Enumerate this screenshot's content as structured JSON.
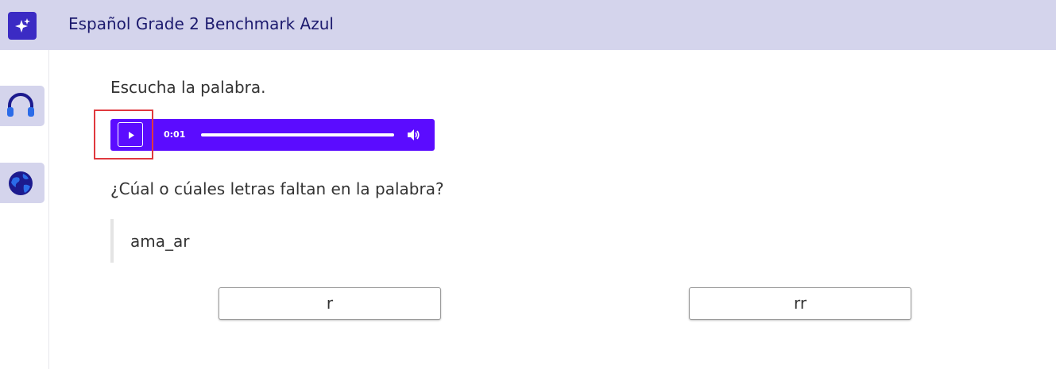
{
  "header": {
    "title": "Español Grade 2 Benchmark Azul",
    "logo_icon": "sparkle-icon"
  },
  "sidebar": {
    "items": [
      {
        "icon": "headphones-icon"
      },
      {
        "icon": "globe-icon"
      }
    ]
  },
  "question": {
    "instruction": "Escucha la palabra.",
    "prompt": "¿Cúal o cúales letras faltan en la palabra?",
    "word": "ama_ar"
  },
  "audio_player": {
    "time": "0:01",
    "progress": 0.0,
    "play_icon": "play-icon",
    "volume_icon": "volume-icon"
  },
  "choices": [
    "r",
    "rr"
  ],
  "colors": {
    "header_bg": "#d4d4ec",
    "logo_bg": "#3b2bc4",
    "player_bg": "#5b0cff",
    "highlight": "#e0393e"
  }
}
